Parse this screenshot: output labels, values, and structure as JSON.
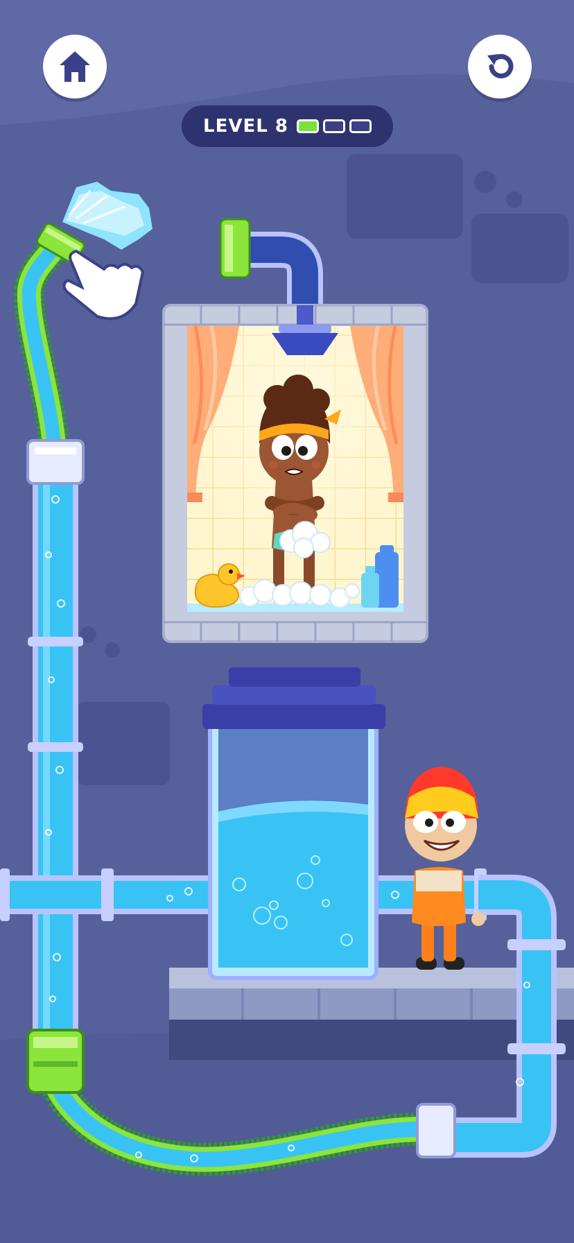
{
  "hud": {
    "level_label": "LEVEL 8",
    "level_progress": {
      "completed": 1,
      "total": 3
    },
    "home_icon": "home-icon",
    "restart_icon": "restart-icon"
  },
  "colors": {
    "background": "#56609a",
    "water": "#39c3f5",
    "pipe_green": "#8be53a",
    "pipe_frame": "#b9c4ff",
    "tank_cap": "#3a3fa8"
  },
  "scene": {
    "shower_room": "shower-scene",
    "characters": [
      "girl-in-shower",
      "plumber-boy"
    ],
    "props": [
      "rubber-duck",
      "shampoo-bottle",
      "shower-head",
      "water-tank",
      "hose",
      "tap-hand-hint"
    ]
  }
}
